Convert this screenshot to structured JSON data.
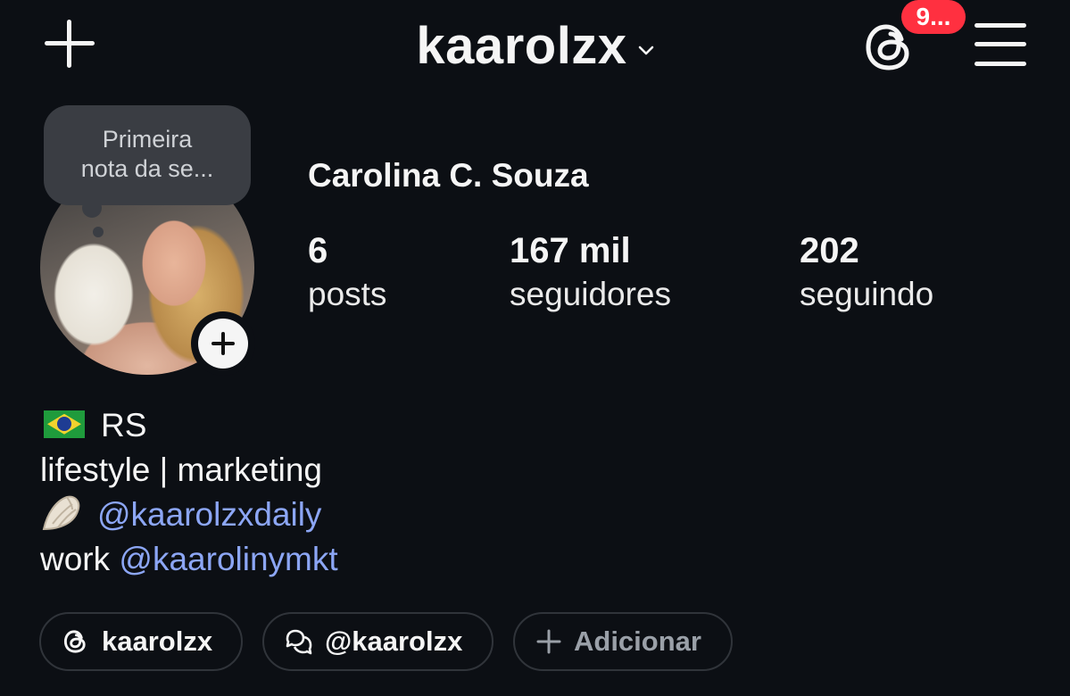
{
  "header": {
    "username": "kaarolzx",
    "notification_count": "9...",
    "icons": {
      "create": "plus-icon",
      "switch_account": "chevron-down-icon",
      "threads": "threads-icon",
      "menu": "hamburger-menu-icon"
    }
  },
  "profile": {
    "note": "Primeira nota da se...",
    "full_name": "Carolina C. Souza",
    "stats": {
      "posts": {
        "value": "6",
        "label": "posts"
      },
      "followers": {
        "value": "167 mil",
        "label": "seguidores"
      },
      "following": {
        "value": "202",
        "label": "seguindo"
      }
    }
  },
  "bio": {
    "line1_text": "RS",
    "line1_icon": "brazil-flag-icon",
    "line2_text": "lifestyle | marketing",
    "line3_icon": "spiral-shell-icon",
    "line3_link": "@kaarolzxdaily",
    "line4_text": "work ",
    "line4_link": "@kaarolinymkt",
    "link_color": "#8ca6f5"
  },
  "chips": [
    {
      "label": "kaarolzx",
      "icon": "threads-icon"
    },
    {
      "label": "@kaarolzx",
      "icon": "message-bubbles-icon"
    },
    {
      "label": "Adicionar",
      "icon": "plus-icon"
    }
  ],
  "colors": {
    "background": "#0c0f14",
    "badge": "#ff3040"
  }
}
